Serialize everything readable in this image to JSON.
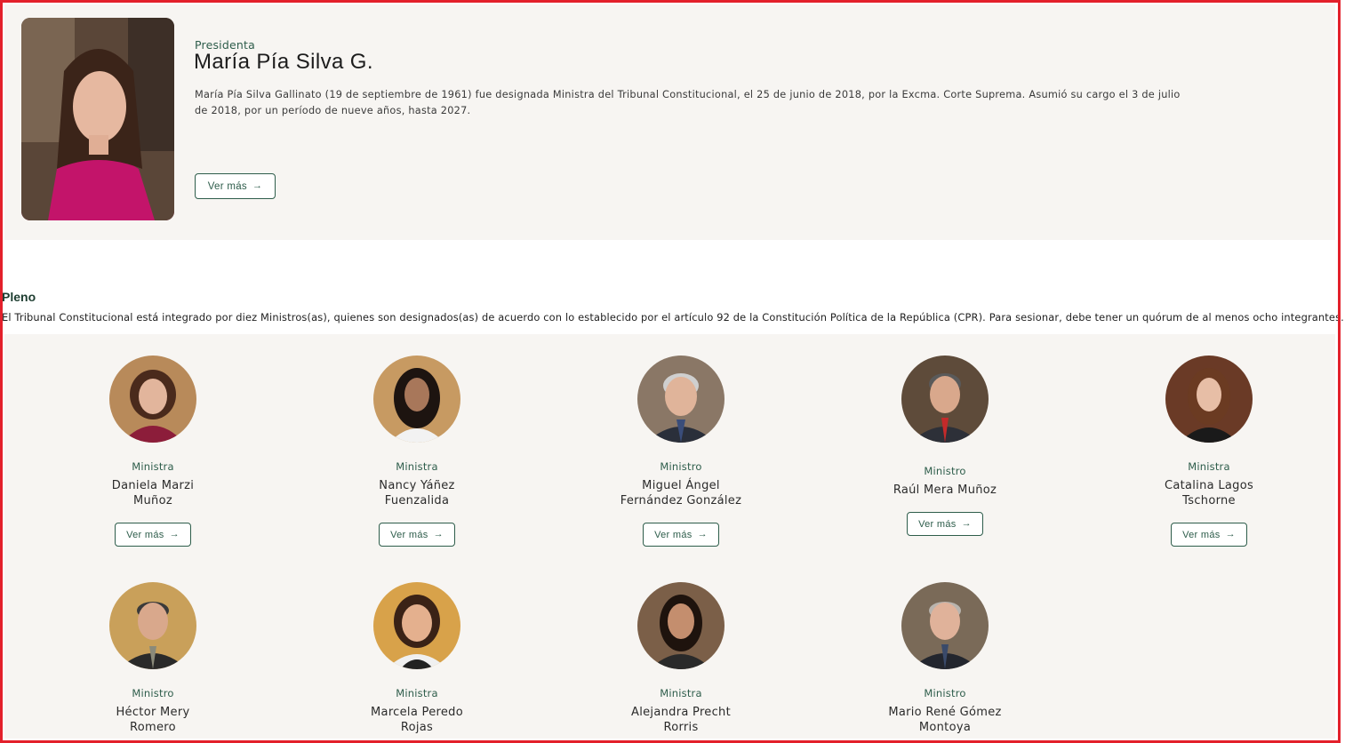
{
  "president": {
    "role": "Presidenta",
    "name": "María Pía Silva G.",
    "description": "María Pía Silva Gallinato (19 de septiembre de 1961) fue designada Ministra del Tribunal Constitucional, el 25 de junio de 2018, por la Excma. Corte Suprema. Asumió su cargo el 3 de julio de 2018, por un período de nueve años, hasta 2027.",
    "button_label": "Ver más",
    "button_icon": "arrow-right-icon"
  },
  "pleno": {
    "title": "Pleno",
    "description": "El Tribunal Constitucional está integrado por diez Ministros(as), quienes son designados(as) de acuerdo con lo establecido por el artículo 92 de la Constitución Política de la República (CPR). Para sesionar, debe tener un quórum de al menos ocho integrantes."
  },
  "members": [
    {
      "role": "Ministra",
      "name_line1": "Daniela Marzi",
      "name_line2": "Muñoz",
      "button_label": "Ver más"
    },
    {
      "role": "Ministra",
      "name_line1": "Nancy Yáñez",
      "name_line2": "Fuenzalida",
      "button_label": "Ver más"
    },
    {
      "role": "Ministro",
      "name_line1": "Miguel Ángel",
      "name_line2": "Fernández González",
      "button_label": "Ver más"
    },
    {
      "role": "Ministro",
      "name_line1": "Raúl Mera Muñoz",
      "name_line2": "",
      "button_label": "Ver más"
    },
    {
      "role": "Ministra",
      "name_line1": "Catalina Lagos",
      "name_line2": "Tschorne",
      "button_label": "Ver más"
    },
    {
      "role": "Ministro",
      "name_line1": "Héctor Mery",
      "name_line2": "Romero",
      "button_label": "Ver más"
    },
    {
      "role": "Ministra",
      "name_line1": "Marcela Peredo",
      "name_line2": "Rojas",
      "button_label": "Ver más"
    },
    {
      "role": "Ministra",
      "name_line1": "Alejandra Precht",
      "name_line2": "Rorris",
      "button_label": "Ver más"
    },
    {
      "role": "Ministro",
      "name_line1": "Mario René Gómez",
      "name_line2": "Montoya",
      "button_label": "Ver más"
    }
  ],
  "colors": {
    "accent": "#2e5d4b",
    "panel_bg": "#f7f5f2",
    "frame": "#e3202b"
  }
}
